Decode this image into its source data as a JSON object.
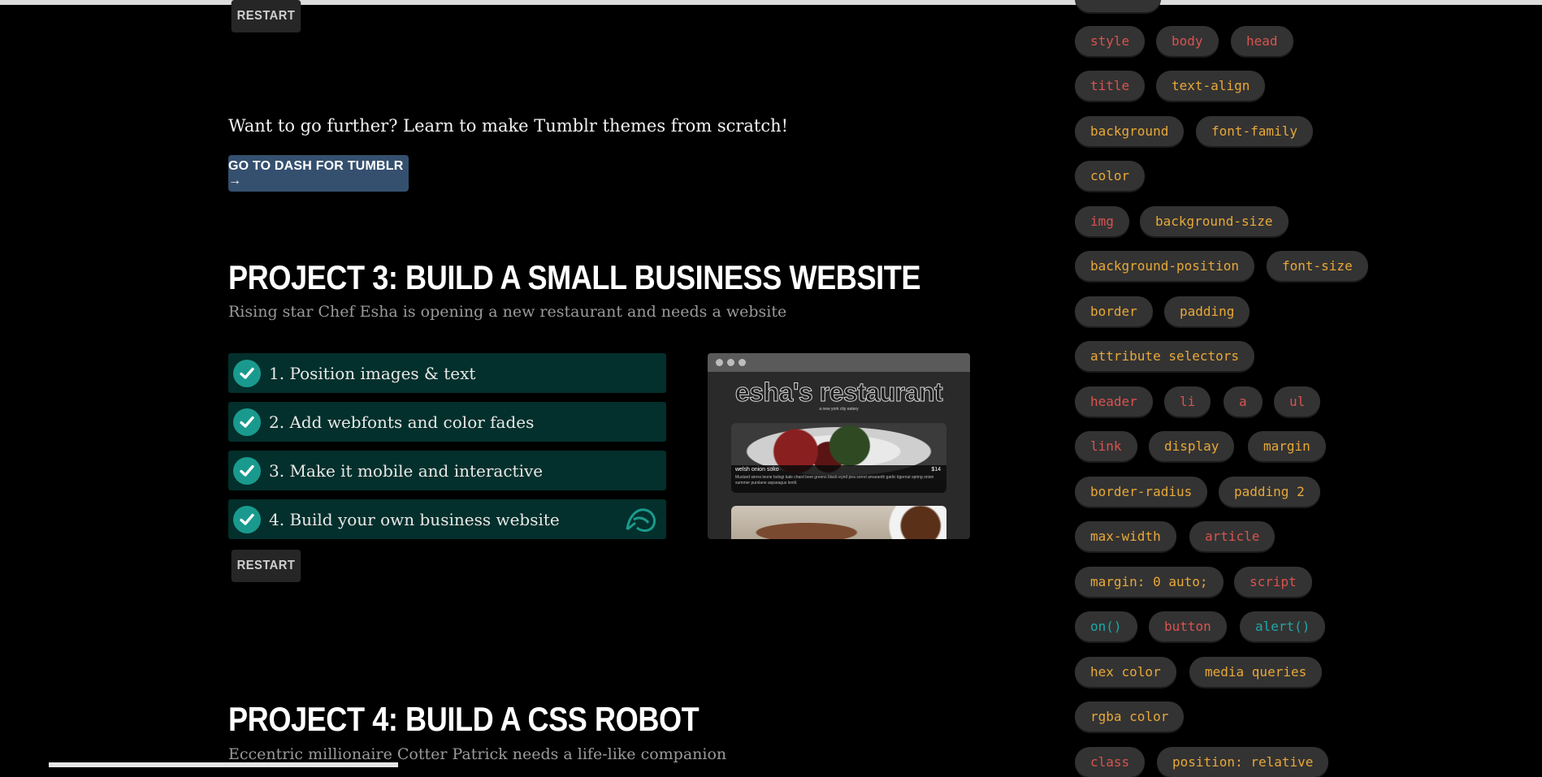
{
  "buttons": {
    "restart_top": "RESTART",
    "go_to_dash": "GO TO DASH FOR TUMBLR →",
    "restart_project3": "RESTART"
  },
  "further_text": "Want to go further? Learn to make Tumblr themes from scratch!",
  "project3": {
    "title": "PROJECT 3: BUILD A SMALL BUSINESS WEBSITE",
    "subtitle": "Rising star Chef Esha is opening a new restaurant and needs a website",
    "steps": [
      {
        "label": "1. Position images & text"
      },
      {
        "label": "2. Add webfonts and color fades"
      },
      {
        "label": "3. Make it mobile and interactive"
      },
      {
        "label": "4. Build your own business website"
      }
    ],
    "preview": {
      "title": "esha's restaurant",
      "tagline": "a new york city eatery",
      "dish_name": "welsh onion soko",
      "dish_price": "$14",
      "dish_desc": "Mustard sierra leone bologi kale chard beet greens black-eyed pea sorrel amaranth garlic tigernut spring onion summer purslane asparagus lentil."
    }
  },
  "project4": {
    "title": "PROJECT 4: BUILD A CSS ROBOT",
    "subtitle": "Eccentric millionaire Cotter Patrick needs a life-like companion"
  },
  "colors": {
    "tag_red": "#d9534f",
    "tag_orange": "#e8a838",
    "tag_teal": "#1fa7a7",
    "step_bg": "#03302c",
    "check": "#1a9a8e",
    "dash_button": "#35506f"
  },
  "sidebar_tags": [
    {
      "text": "style",
      "color": "red"
    },
    {
      "text": "body",
      "color": "red"
    },
    {
      "text": "head",
      "color": "red"
    },
    {
      "text": "title",
      "color": "red"
    },
    {
      "text": "text-align",
      "color": "orange"
    },
    {
      "text": "background",
      "color": "orange"
    },
    {
      "text": "font-family",
      "color": "orange"
    },
    {
      "text": "color",
      "color": "orange"
    },
    {
      "text": "img",
      "color": "red"
    },
    {
      "text": "background-size",
      "color": "orange"
    },
    {
      "text": "background-position",
      "color": "orange"
    },
    {
      "text": "font-size",
      "color": "orange"
    },
    {
      "text": "border",
      "color": "orange"
    },
    {
      "text": "padding",
      "color": "orange"
    },
    {
      "text": "attribute selectors",
      "color": "orange"
    },
    {
      "text": "header",
      "color": "red"
    },
    {
      "text": "li",
      "color": "red"
    },
    {
      "text": "a",
      "color": "red"
    },
    {
      "text": "ul",
      "color": "red"
    },
    {
      "text": "link",
      "color": "red"
    },
    {
      "text": "display",
      "color": "orange"
    },
    {
      "text": "margin",
      "color": "orange"
    },
    {
      "text": "border-radius",
      "color": "orange"
    },
    {
      "text": "padding 2",
      "color": "orange"
    },
    {
      "text": "max-width",
      "color": "orange"
    },
    {
      "text": "article",
      "color": "red"
    },
    {
      "text": "margin: 0 auto;",
      "color": "orange"
    },
    {
      "text": "script",
      "color": "red"
    },
    {
      "text": "on()",
      "color": "teal"
    },
    {
      "text": "button",
      "color": "red"
    },
    {
      "text": "alert()",
      "color": "teal"
    },
    {
      "text": "hex color",
      "color": "orange"
    },
    {
      "text": "media queries",
      "color": "orange"
    },
    {
      "text": "rgba color",
      "color": "orange"
    },
    {
      "text": "class",
      "color": "red"
    },
    {
      "text": "position: relative",
      "color": "orange"
    }
  ]
}
